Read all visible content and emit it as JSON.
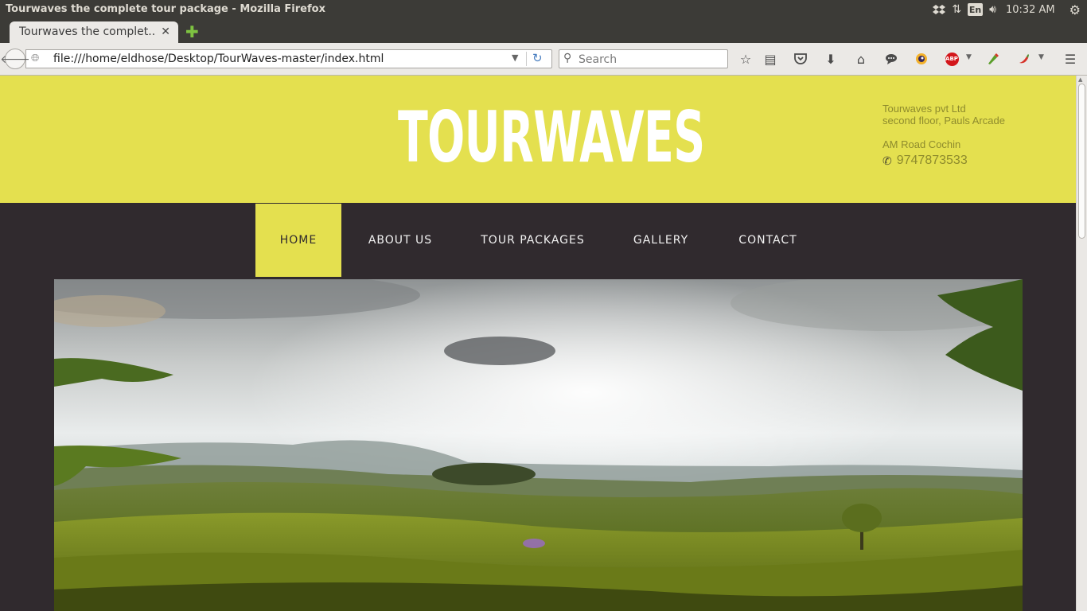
{
  "os": {
    "window_title": "Tourwaves the complete tour package - Mozilla Firefox",
    "keyboard_layout": "En",
    "clock": "10:32 AM"
  },
  "browser": {
    "tab_title": "Tourwaves the complet...",
    "url": "file:///home/eldhose/Desktop/TourWaves-master/index.html",
    "search_placeholder": "Search"
  },
  "site": {
    "brand": "TOURWAVES",
    "address": {
      "line1": "Tourwaves pvt Ltd",
      "line2": "second floor, Pauls Arcade",
      "line3": "AM Road Cochin"
    },
    "phone": "9747873533",
    "nav": [
      {
        "label": "HOME",
        "active": true
      },
      {
        "label": "ABOUT US",
        "active": false
      },
      {
        "label": "TOUR PACKAGES",
        "active": false
      },
      {
        "label": "GALLERY",
        "active": false
      },
      {
        "label": "CONTACT",
        "active": false
      }
    ],
    "colors": {
      "accent": "#e4e04f",
      "dark": "#302a2e",
      "address_text": "#8e8b2d"
    }
  }
}
